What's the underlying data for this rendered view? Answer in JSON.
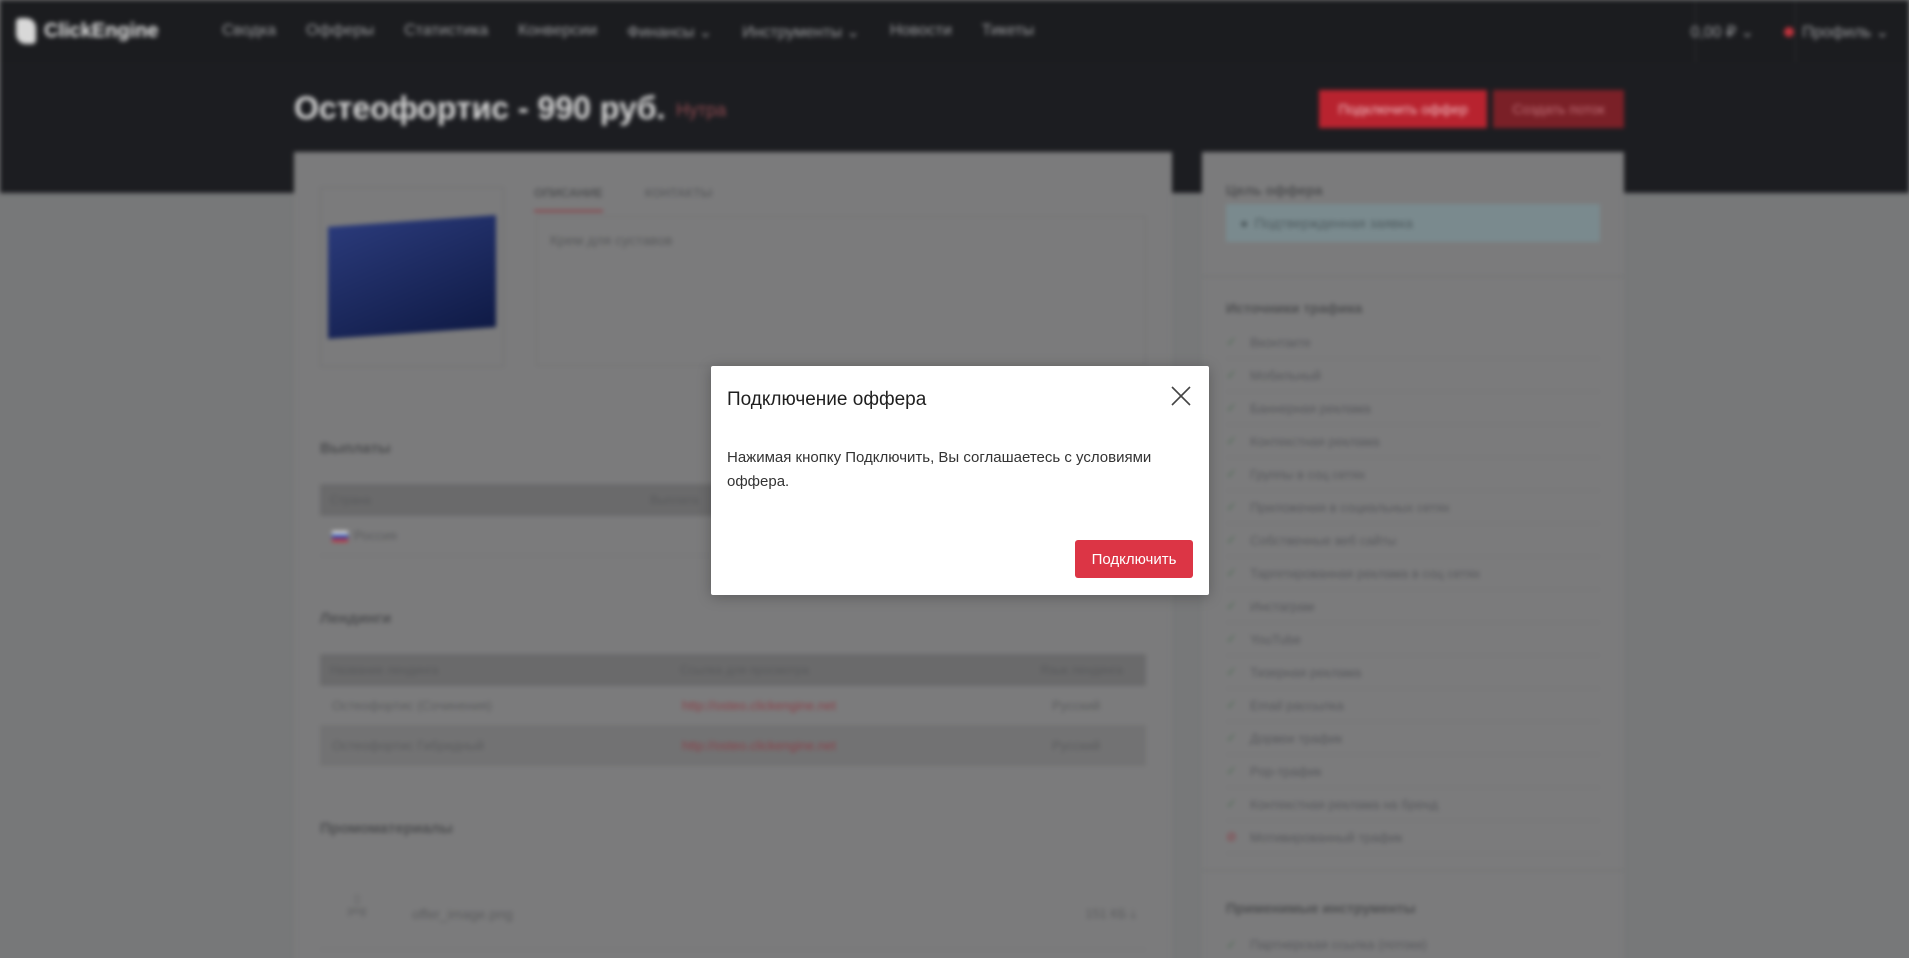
{
  "app": {
    "logo_text": "ClickEngine"
  },
  "nav": {
    "items": [
      "Сводка",
      "Офферы",
      "Статистика",
      "Конверсии",
      "Финансы",
      "Инструменты",
      "Новости",
      "Тикеты"
    ],
    "currency": "0,00 ₽",
    "user": "Профиль"
  },
  "offer": {
    "title": "Остеофортис - 990 руб.",
    "subtitle": "Нутра",
    "connect_label": "Подключить оффер",
    "create_label": "Создать поток",
    "tabs": [
      "ОПИСАНИЕ",
      "КОНТАКТЫ"
    ],
    "description": "Крем для суставов"
  },
  "payouts": {
    "heading": "Выплаты",
    "columns": [
      "Страна",
      "Выплата"
    ],
    "rows": [
      [
        "Россия",
        ""
      ]
    ]
  },
  "landings": {
    "heading": "Лендинги",
    "columns": [
      "Название лендинга",
      "Ссылка для просмотра",
      "Язык лендинга"
    ],
    "rows": [
      [
        "Остеофортис (Сочинения)",
        "http://osteo.clickengine.net",
        "Русский"
      ],
      [
        "Остеофортис Гибридный",
        "http://osteo.clickengine.net",
        "Русский"
      ]
    ]
  },
  "promo": {
    "heading": "Промоматериалы",
    "file_name": "offer_image.png",
    "file_ext": "png",
    "file_size": "151 КБ"
  },
  "sidebar": {
    "goal_heading": "Цель оффера",
    "goal_value": "Подтвержденная заявка",
    "sources_heading": "Источники трафика",
    "sources": [
      {
        "label": "Вконтакте",
        "ok": true
      },
      {
        "label": "Мобильный",
        "ok": true
      },
      {
        "label": "Баннерная реклама",
        "ok": true
      },
      {
        "label": "Контекстная реклама",
        "ok": true
      },
      {
        "label": "Группы в соц сетях",
        "ok": true
      },
      {
        "label": "Приложения в социальных сетях",
        "ok": true
      },
      {
        "label": "Собственные веб сайты",
        "ok": true
      },
      {
        "label": "Таргетированная реклама в соц сетях",
        "ok": true
      },
      {
        "label": "Инстаграм",
        "ok": true
      },
      {
        "label": "YouTube",
        "ok": true
      },
      {
        "label": "Тизерная реклама",
        "ok": true
      },
      {
        "label": "Email рассылка",
        "ok": true
      },
      {
        "label": "Дорвеи трафик",
        "ok": true
      },
      {
        "label": "Pop-трафик",
        "ok": true
      },
      {
        "label": "Контекстная реклама на бренд",
        "ok": true
      },
      {
        "label": "Мотивированный трафик",
        "ok": false
      }
    ],
    "tools_heading": "Применимые инструменты",
    "tools": [
      "Партнерская ссылка (потоки)"
    ]
  },
  "modal": {
    "title": "Подключение оффера",
    "body": "Нажимая кнопку Подключить, Вы соглашаетесь с условиями оффера.",
    "confirm_label": "Подключить"
  }
}
